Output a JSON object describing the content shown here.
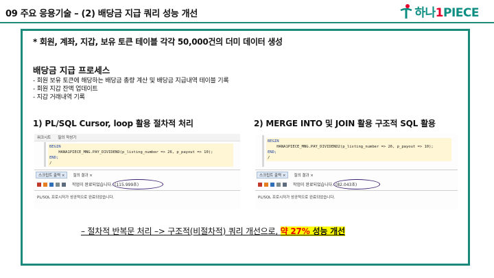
{
  "header": {
    "title": "09 주요 응용기술 – (2) 배당금 지급 쿼리 성능 개선",
    "logo": {
      "prefix": "하나",
      "number": "1",
      "suffix": "PIECE"
    }
  },
  "intro": "* 회원, 계좌, 지갑, 보유 토큰 테이블 각각 50,000건의 더미 데이터 생성",
  "process": {
    "title": "배당금 지급 프로세스",
    "steps": [
      "- 회원 보유 토큰에 해당하는 배당금 총량 계산 및 배당금 지급내역 테이블 기록",
      "- 회원 지갑 잔액 업데이트",
      "- 지갑 거래내역 기록"
    ]
  },
  "left": {
    "title": "1) PL/SQL Cursor, loop 활용 절차적 처리",
    "tabs": [
      "워크시트",
      "질의 작성기"
    ],
    "code": [
      "BEGIN",
      "    HANA1PIECE_MNG.PAY_DIVIDEND(p_listing_number => 26, p_payout => 10);",
      "END;",
      "/"
    ],
    "output_tabs": [
      "스크립트 출력 ×",
      "질의 결과 ×"
    ],
    "task_done": "작업이 완료되었습니다.",
    "elapsed": "(115.999초)",
    "status": "PL/SQL 프로시저가 성공적으로 완료되었습니다."
  },
  "right": {
    "title": "2) MERGE INTO 및 JOIN 활용 구조적 SQL 활용",
    "code": [
      "BEGIN",
      "    HANA1PIECE_MNG.PAY_DIVIDEND2(p_listing_number => 26, p_payout => 10);",
      "END;",
      "/"
    ],
    "output_tabs": [
      "스크립트 출력 ×",
      "질의 결과 ×"
    ],
    "task_done": "작업이 완료되었습니다.",
    "elapsed": "(82.043초)",
    "status": "PL/SQL 프로시저가 성공적으로 완료되었습니다."
  },
  "conclusion": {
    "text": "– 절차적 반복문 처리 –> 구조적(비절차적) 쿼리 개선으로, ",
    "highlight_red": "약 27%",
    "highlight_rest": " 성능 개선"
  },
  "colors": {
    "accent": "#1a8a7c",
    "brand": "#0d8e82",
    "brand_red": "#e4002b",
    "highlight": "#ffff00"
  }
}
